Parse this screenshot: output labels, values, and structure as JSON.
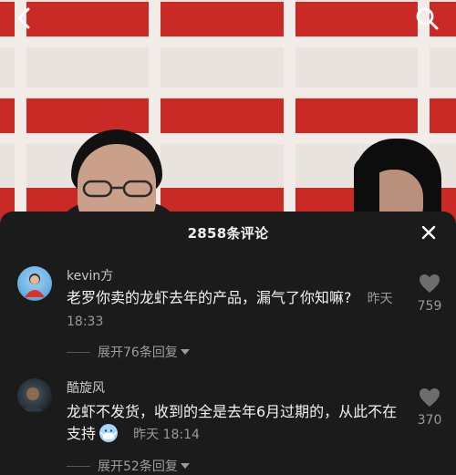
{
  "header": {
    "back_icon": "chevron-left-icon",
    "search_icon": "search-icon"
  },
  "sheet": {
    "title": "2858条评论",
    "close_icon": "close-icon"
  },
  "comments": [
    {
      "username": "kevin方",
      "text": "老罗你卖的龙虾去年的产品，漏气了你知嘛?",
      "time": "昨天 18:33",
      "likes": "759",
      "replies": "展开76条回复"
    },
    {
      "username": "酷旋风",
      "text": "龙虾不发货，收到的全是去年6月过期的，从此不在支持",
      "emoji_icon": "masked-face-icon",
      "time": "昨天 18:14",
      "likes": "370",
      "replies": "展开52条回复"
    }
  ],
  "colors": {
    "sheet_bg": "#1b1b1b",
    "stripe_red": "#c92a25",
    "text_primary": "#f2f2f2",
    "text_secondary": "#9a9a9a"
  }
}
